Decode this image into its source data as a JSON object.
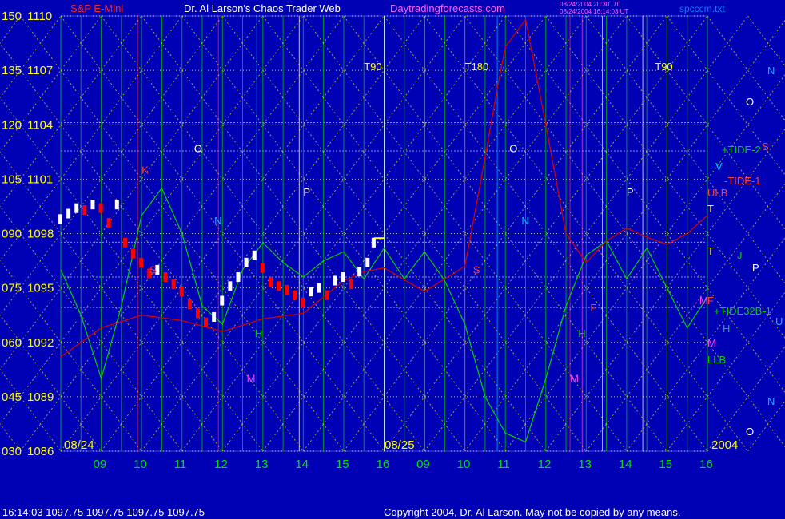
{
  "header": {
    "title_left": "S&P E-Mini",
    "title_center": "Dr. Al Larson's Chaos Trader Web",
    "site": "Daytradingforecasts.com",
    "stamp_line1": "08/24/2004 20:30 UT",
    "stamp_line2": "08/24/2004 16:14:03 UT",
    "file": "spcccm.txt"
  },
  "footer": {
    "quote": "16:14:03  1097.75 1097.75 1097.75 1097.75",
    "copyright": "Copyright 2004, Dr. Al Larson. May not be copied by any means."
  },
  "colors": {
    "background": "#0000b4",
    "yellow": "#ffff00",
    "green_line": "#00d000",
    "red_line": "#d00000",
    "price_white": "#ffffff",
    "price_red": "#ff0000"
  },
  "chart_data": {
    "type": "line",
    "y_axis_left": [
      "150",
      "135",
      "120",
      "105",
      "090",
      "075",
      "060",
      "045",
      "030"
    ],
    "y_axis_prices": [
      "1110",
      "1107",
      "1104",
      "1101",
      "1098",
      "1095",
      "1092",
      "1089",
      "1086"
    ],
    "ylim": [
      1086,
      1110
    ],
    "date_labels": [
      "08/24",
      "08/25",
      "2004"
    ],
    "x_ticks": [
      "09",
      "10",
      "11",
      "12",
      "13",
      "14",
      "15",
      "16",
      "09",
      "10",
      "11",
      "12",
      "13",
      "14",
      "15",
      "16"
    ],
    "markers": [
      {
        "label": "T90",
        "color": "#ffff00"
      },
      {
        "label": "T180",
        "color": "#ffff00"
      },
      {
        "label": "T90",
        "color": "#ffff00"
      },
      {
        "label": "O",
        "color": "#ffffff"
      },
      {
        "label": "O",
        "color": "#ffffff"
      },
      {
        "label": "N",
        "color": "#00c0ff"
      },
      {
        "label": "N",
        "color": "#00c0ff"
      },
      {
        "label": "P",
        "color": "#ffffff"
      },
      {
        "label": "P",
        "color": "#ffffff"
      },
      {
        "label": "S",
        "color": "#ff4040"
      },
      {
        "label": "S",
        "color": "#ff4040"
      },
      {
        "label": "H",
        "color": "#00d000"
      },
      {
        "label": "H",
        "color": "#00d000"
      },
      {
        "label": "M",
        "color": "#ff40ff"
      },
      {
        "label": "M",
        "color": "#ff40ff"
      },
      {
        "label": "M",
        "color": "#ff40ff"
      },
      {
        "label": "K",
        "color": "#ff4040"
      },
      {
        "label": "F",
        "color": "#ff4040"
      }
    ],
    "right_labels": [
      {
        "label": "N",
        "color": "#00c0ff"
      },
      {
        "label": "O",
        "color": "#ffffff"
      },
      {
        "label": "+TIDE-2",
        "color": "#00d000"
      },
      {
        "label": "S",
        "color": "#ff4040"
      },
      {
        "label": "V",
        "color": "#00c0ff"
      },
      {
        "label": "-TIDE-1",
        "color": "#ff4040"
      },
      {
        "label": "ULB",
        "color": "#ff4040"
      },
      {
        "label": "T",
        "color": "#ffff00"
      },
      {
        "label": "T",
        "color": "#ffff00"
      },
      {
        "label": "J",
        "color": "#00d000"
      },
      {
        "label": "P",
        "color": "#ffffff"
      },
      {
        "label": "F",
        "color": "#ff4040"
      },
      {
        "label": "+TIDE32B-1",
        "color": "#00d000"
      },
      {
        "label": "U",
        "color": "#00c0ff"
      },
      {
        "label": "H",
        "color": "#00d000"
      },
      {
        "label": "M",
        "color": "#ff40ff"
      },
      {
        "label": "LLB",
        "color": "#00d000"
      },
      {
        "label": "N",
        "color": "#00c0ff"
      },
      {
        "label": "O",
        "color": "#ffffff"
      }
    ],
    "price_series": [
      {
        "x": 0.0,
        "y": 1098.8
      },
      {
        "x": 0.2,
        "y": 1099.1
      },
      {
        "x": 0.4,
        "y": 1099.4
      },
      {
        "x": 0.6,
        "y": 1099.3
      },
      {
        "x": 0.8,
        "y": 1099.6
      },
      {
        "x": 1.0,
        "y": 1099.4
      },
      {
        "x": 1.2,
        "y": 1098.6
      },
      {
        "x": 1.4,
        "y": 1099.6
      },
      {
        "x": 1.6,
        "y": 1097.5
      },
      {
        "x": 1.8,
        "y": 1096.9
      },
      {
        "x": 2.0,
        "y": 1096.4
      },
      {
        "x": 2.2,
        "y": 1095.8
      },
      {
        "x": 2.4,
        "y": 1096.0
      },
      {
        "x": 2.6,
        "y": 1095.6
      },
      {
        "x": 2.8,
        "y": 1095.2
      },
      {
        "x": 3.0,
        "y": 1094.8
      },
      {
        "x": 3.2,
        "y": 1094.1
      },
      {
        "x": 3.4,
        "y": 1093.6
      },
      {
        "x": 3.6,
        "y": 1093.1
      },
      {
        "x": 3.8,
        "y": 1093.4
      },
      {
        "x": 4.0,
        "y": 1094.3
      },
      {
        "x": 4.2,
        "y": 1095.1
      },
      {
        "x": 4.4,
        "y": 1095.6
      },
      {
        "x": 4.6,
        "y": 1096.4
      },
      {
        "x": 4.8,
        "y": 1096.8
      },
      {
        "x": 5.0,
        "y": 1096.1
      },
      {
        "x": 5.2,
        "y": 1095.3
      },
      {
        "x": 5.4,
        "y": 1095.1
      },
      {
        "x": 5.6,
        "y": 1094.9
      },
      {
        "x": 5.8,
        "y": 1094.6
      },
      {
        "x": 6.0,
        "y": 1094.2
      },
      {
        "x": 6.2,
        "y": 1094.8
      },
      {
        "x": 6.4,
        "y": 1095.0
      },
      {
        "x": 6.6,
        "y": 1094.6
      },
      {
        "x": 6.8,
        "y": 1095.4
      },
      {
        "x": 7.0,
        "y": 1095.6
      },
      {
        "x": 7.2,
        "y": 1095.2
      },
      {
        "x": 7.4,
        "y": 1095.9
      },
      {
        "x": 7.6,
        "y": 1096.4
      },
      {
        "x": 7.75,
        "y": 1097.5
      }
    ],
    "forecast_red_series": [
      {
        "x": 0.0,
        "y": 1091.2
      },
      {
        "x": 1.0,
        "y": 1092.8
      },
      {
        "x": 2.0,
        "y": 1093.5
      },
      {
        "x": 3.0,
        "y": 1093.2
      },
      {
        "x": 4.0,
        "y": 1092.6
      },
      {
        "x": 5.0,
        "y": 1093.3
      },
      {
        "x": 6.0,
        "y": 1093.6
      },
      {
        "x": 7.0,
        "y": 1095.4
      },
      {
        "x": 7.5,
        "y": 1095.9
      },
      {
        "x": 8.0,
        "y": 1096.1
      },
      {
        "x": 9.0,
        "y": 1094.8
      },
      {
        "x": 10.0,
        "y": 1096.2
      },
      {
        "x": 10.4,
        "y": 1101.0
      },
      {
        "x": 10.8,
        "y": 1106.0
      },
      {
        "x": 11.0,
        "y": 1108.3
      },
      {
        "x": 11.5,
        "y": 1109.8
      },
      {
        "x": 12.0,
        "y": 1104.0
      },
      {
        "x": 12.5,
        "y": 1098.0
      },
      {
        "x": 13.0,
        "y": 1096.4
      },
      {
        "x": 13.5,
        "y": 1097.6
      },
      {
        "x": 14.0,
        "y": 1098.3
      },
      {
        "x": 14.5,
        "y": 1097.8
      },
      {
        "x": 15.0,
        "y": 1097.4
      },
      {
        "x": 15.5,
        "y": 1098.0
      },
      {
        "x": 16.0,
        "y": 1099.0
      }
    ],
    "forecast_green_series": [
      {
        "x": 0.0,
        "y": 1096.0
      },
      {
        "x": 0.5,
        "y": 1093.5
      },
      {
        "x": 1.0,
        "y": 1090.0
      },
      {
        "x": 1.5,
        "y": 1094.0
      },
      {
        "x": 2.0,
        "y": 1099.0
      },
      {
        "x": 2.5,
        "y": 1100.5
      },
      {
        "x": 3.0,
        "y": 1098.0
      },
      {
        "x": 3.5,
        "y": 1094.0
      },
      {
        "x": 4.0,
        "y": 1093.0
      },
      {
        "x": 4.5,
        "y": 1096.0
      },
      {
        "x": 5.0,
        "y": 1097.5
      },
      {
        "x": 5.5,
        "y": 1096.4
      },
      {
        "x": 6.0,
        "y": 1095.6
      },
      {
        "x": 6.5,
        "y": 1096.5
      },
      {
        "x": 7.0,
        "y": 1097.0
      },
      {
        "x": 7.5,
        "y": 1095.5
      },
      {
        "x": 8.0,
        "y": 1097.2
      },
      {
        "x": 8.5,
        "y": 1095.5
      },
      {
        "x": 9.0,
        "y": 1097.0
      },
      {
        "x": 9.5,
        "y": 1095.4
      },
      {
        "x": 10.0,
        "y": 1093.0
      },
      {
        "x": 10.5,
        "y": 1089.0
      },
      {
        "x": 11.0,
        "y": 1087.0
      },
      {
        "x": 11.5,
        "y": 1086.5
      },
      {
        "x": 12.0,
        "y": 1090.0
      },
      {
        "x": 12.5,
        "y": 1094.0
      },
      {
        "x": 13.0,
        "y": 1096.8
      },
      {
        "x": 13.5,
        "y": 1097.6
      },
      {
        "x": 14.0,
        "y": 1095.5
      },
      {
        "x": 14.5,
        "y": 1097.2
      },
      {
        "x": 15.0,
        "y": 1095.0
      },
      {
        "x": 15.5,
        "y": 1092.8
      },
      {
        "x": 16.0,
        "y": 1094.5
      }
    ]
  }
}
